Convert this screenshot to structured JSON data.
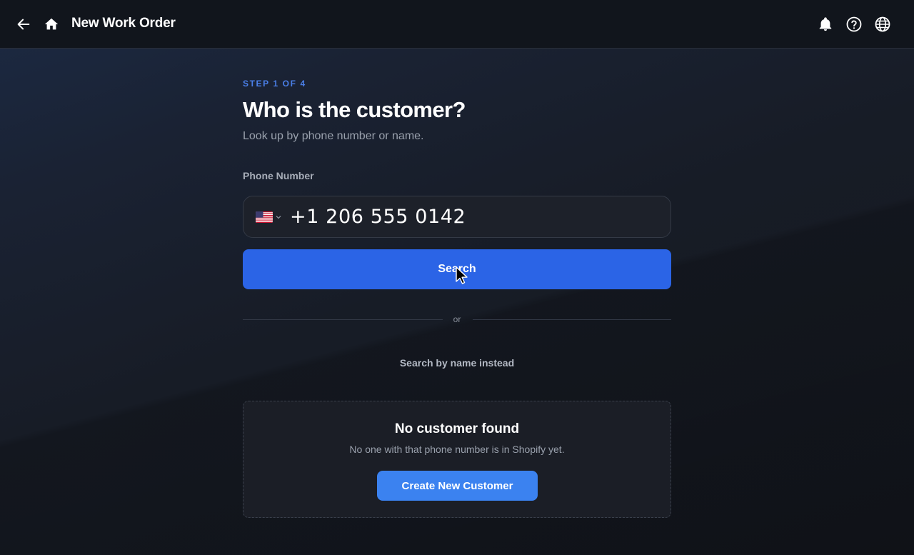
{
  "header": {
    "title": "New Work Order",
    "icons": [
      "arrow-left-icon",
      "home-icon",
      "bell-icon",
      "help-circle-icon",
      "globe-icon"
    ]
  },
  "wizard": {
    "step_label": "STEP 1 OF 4",
    "heading": "Who is the customer?",
    "subheading": "Look up by phone number or name."
  },
  "phone": {
    "label": "Phone Number",
    "country": "US",
    "value": "+1 206 555 0142"
  },
  "search_button": "Search",
  "divider_text": "or",
  "name_search_link": "Search by name instead",
  "result": {
    "title": "No customer found",
    "message": "No one with that phone number is in Shopify yet.",
    "action_label": "Create New Customer"
  },
  "colors": {
    "accent": "#2b64e6",
    "accent_light": "#3b82f0",
    "step_label": "#4a7fe8",
    "topbar": "#11151c"
  }
}
